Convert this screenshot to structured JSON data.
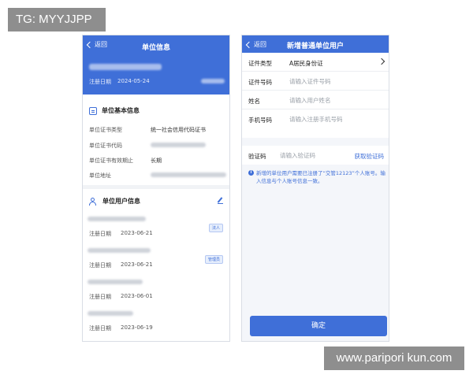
{
  "watermarks": {
    "top": "TG: MYYJJPP",
    "bottom": "www.paripori kun.com"
  },
  "left_screen": {
    "back_label": "返回",
    "title": "单位信息",
    "reg_label": "注册日期",
    "reg_date": "2024-05-24",
    "basic_section": {
      "title": "单位基本信息",
      "rows": [
        {
          "label": "单位证书类型",
          "value": "统一社会信用代码证书"
        },
        {
          "label": "单位证书代码",
          "value": ""
        },
        {
          "label": "单位证书有效期止",
          "value": "长期"
        },
        {
          "label": "单位地址",
          "value": ""
        }
      ]
    },
    "users_section": {
      "title": "单位用户信息",
      "users": [
        {
          "date_label": "注册日期",
          "date": "2023-06-21",
          "badge": "法人"
        },
        {
          "date_label": "注册日期",
          "date": "2023-06-21",
          "badge": "管理员"
        },
        {
          "date_label": "注册日期",
          "date": "2023-06-01",
          "badge": ""
        },
        {
          "date_label": "注册日期",
          "date": "2023-06-19",
          "badge": ""
        }
      ]
    }
  },
  "right_screen": {
    "back_label": "返回",
    "title": "新增普通单位用户",
    "fields": {
      "cert_type": {
        "label": "证件类型",
        "value": "A居民身份证"
      },
      "cert_no": {
        "label": "证件号码",
        "placeholder": "请输入证件号码"
      },
      "name": {
        "label": "姓名",
        "placeholder": "请输入用户姓名"
      },
      "phone": {
        "label": "手机号码",
        "placeholder": "请输入注册手机号码"
      }
    },
    "code": {
      "label": "验证码",
      "placeholder": "请输入验证码",
      "link": "获取验证码"
    },
    "notice": "新增的单位用户需要已注册了“交管12123”个人账号。输入信息与个人账号信息一致。",
    "confirm_label": "确定"
  },
  "colors": {
    "primary": "#3f6fd8",
    "page_bg": "#f4f6fa",
    "watermark_bg": "#8e8e8e"
  },
  "icons": [
    "chevron-left-icon",
    "document-icon",
    "user-icon",
    "edit-icon",
    "chevron-right-icon",
    "info-icon"
  ]
}
